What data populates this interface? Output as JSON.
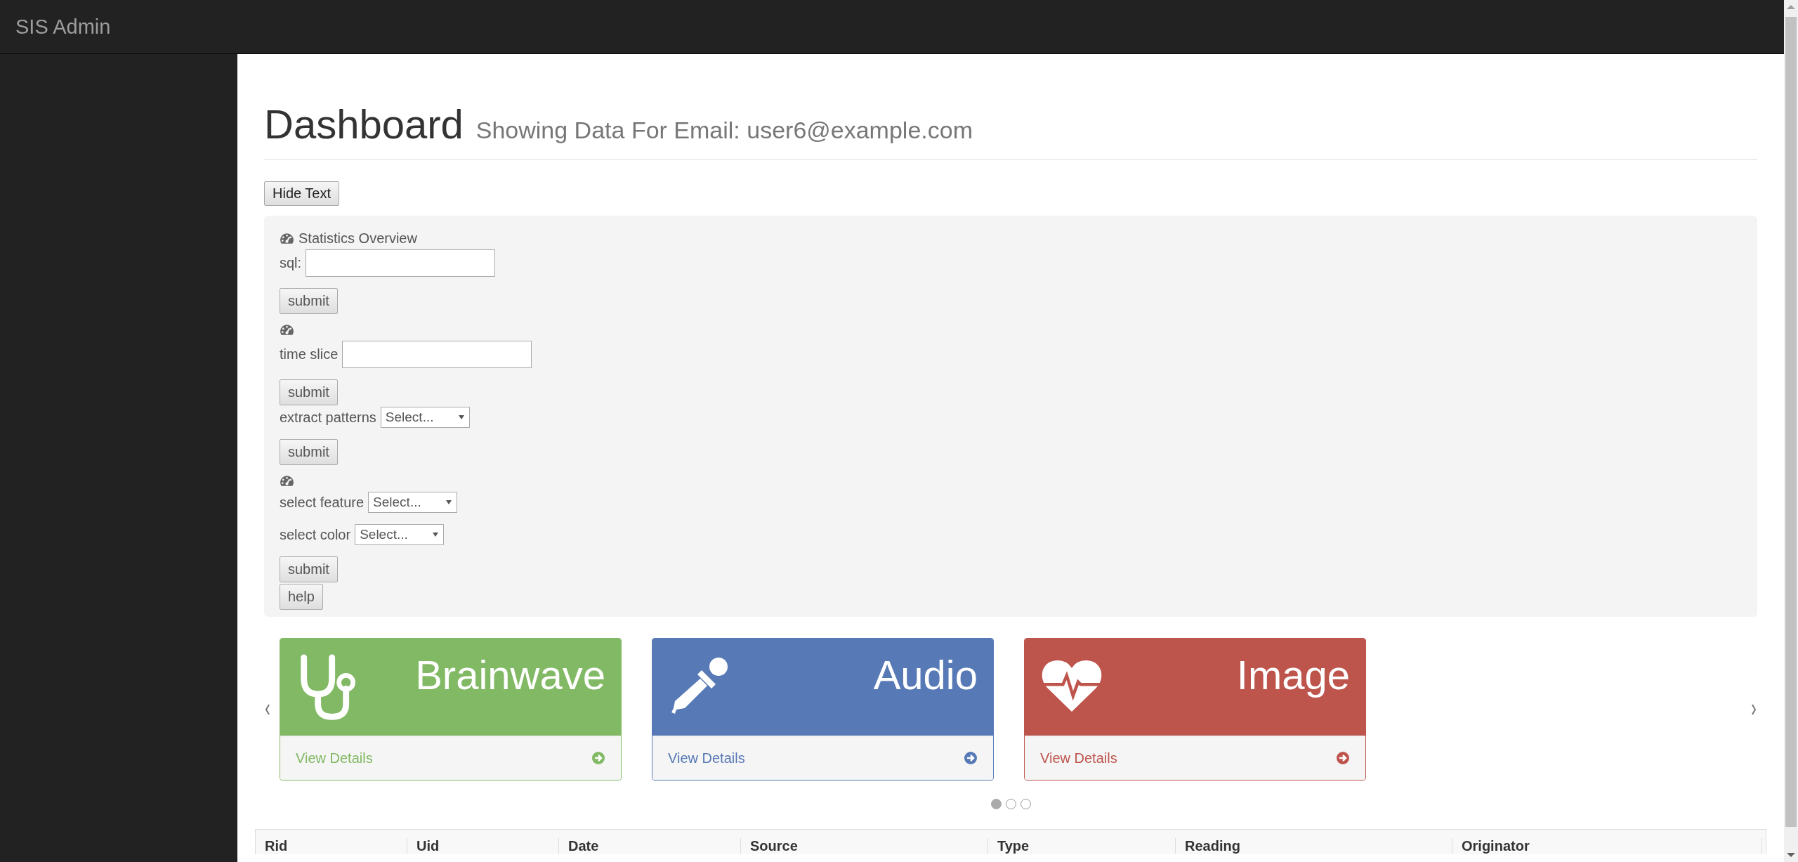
{
  "navbar": {
    "brand": "SIS Admin"
  },
  "header": {
    "title": "Dashboard",
    "subtitle": "Showing Data For Email: user6@example.com"
  },
  "toggle_button": "Hide Text",
  "panel": {
    "items": [
      {
        "kind": "heading",
        "label": "Statistics Overview"
      },
      {
        "kind": "input",
        "label": "sql:",
        "value": ""
      },
      {
        "kind": "button",
        "label": "submit"
      },
      {
        "kind": "heading"
      },
      {
        "kind": "input",
        "label": "time slice",
        "value": ""
      },
      {
        "kind": "button",
        "label": "submit"
      },
      {
        "kind": "select",
        "label": "extract patterns",
        "value": "Select..."
      },
      {
        "kind": "button",
        "label": "submit"
      },
      {
        "kind": "heading"
      },
      {
        "kind": "select",
        "label": "select feature",
        "value": "Select..."
      },
      {
        "kind": "select",
        "label": "select color",
        "value": "Select..."
      },
      {
        "kind": "button",
        "label": "submit"
      },
      {
        "kind": "button",
        "label": "help"
      }
    ]
  },
  "carousel": {
    "cards": [
      {
        "kind": "stethoscope",
        "title": "Brainwave",
        "link": "View Details",
        "color": "#82b964"
      },
      {
        "kind": "dropper",
        "title": "Audio",
        "link": "View Details",
        "color": "#5779b6"
      },
      {
        "kind": "heartbeat",
        "title": "Image",
        "link": "View Details",
        "color": "#be554d"
      }
    ],
    "indicators": [
      {
        "selected": true
      },
      {
        "selected": false
      },
      {
        "selected": false
      }
    ]
  },
  "table": {
    "columns": [
      "Rid",
      "Uid",
      "Date",
      "Source",
      "Type",
      "Reading",
      "Originator"
    ]
  }
}
